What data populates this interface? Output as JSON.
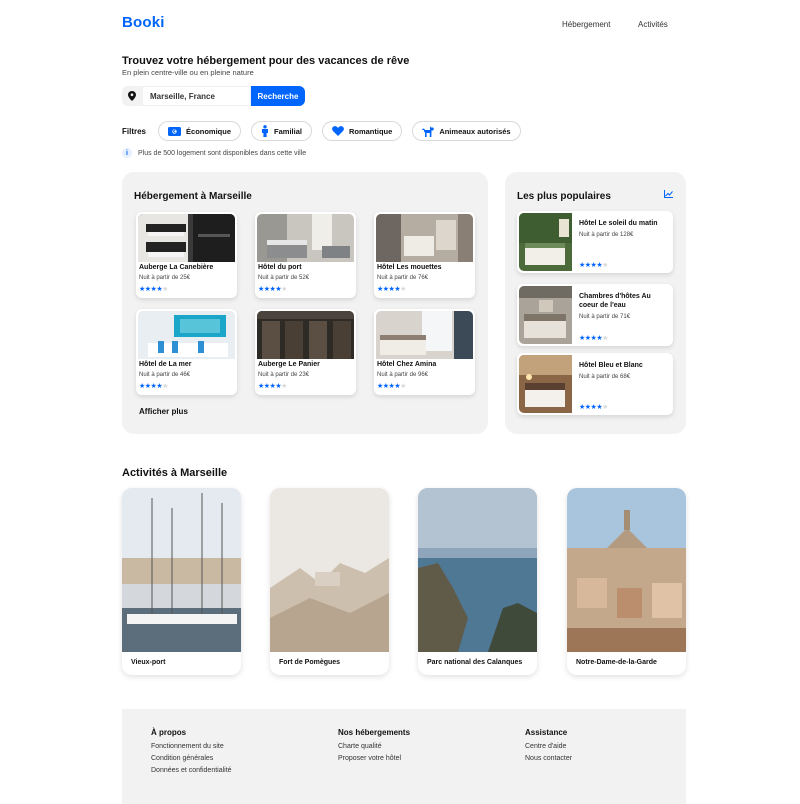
{
  "header": {
    "logo": "Booki",
    "nav": [
      "Hébergement",
      "Activités"
    ]
  },
  "hero": {
    "title": "Trouvez votre hébergement pour des vacances de rêve",
    "subtitle": "En plein centre-ville ou en pleine nature"
  },
  "search": {
    "value": "Marseille, France",
    "button": "Recherche",
    "icon": "location-pin-icon"
  },
  "filters": {
    "label": "Filtres",
    "items": [
      {
        "label": "Économique",
        "icon": "money-icon"
      },
      {
        "label": "Familial",
        "icon": "person-icon"
      },
      {
        "label": "Romantique",
        "icon": "heart-icon"
      },
      {
        "label": "Animeaux autorisés",
        "icon": "dog-icon"
      }
    ]
  },
  "info": {
    "icon_text": "i",
    "text": "Plus de 500 logement sont disponibles dans cette ville"
  },
  "hebergements": {
    "title": "Hébergement à Marseille",
    "more": "Afficher plus",
    "items": [
      {
        "name": "Auberge La Canebière",
        "price": "Nuit à partir de 25€",
        "rating": 4
      },
      {
        "name": "Hôtel du port",
        "price": "Nuit à partir de 52€",
        "rating": 4
      },
      {
        "name": "Hôtel Les mouettes",
        "price": "Nuit à partir de 76€",
        "rating": 4
      },
      {
        "name": "Hôtel de La mer",
        "price": "Nuit à partir de 46€",
        "rating": 4
      },
      {
        "name": "Auberge Le Panier",
        "price": "Nuit à partir de 23€",
        "rating": 4
      },
      {
        "name": "Hôtel Chez Amina",
        "price": "Nuit à partir de 96€",
        "rating": 4
      }
    ]
  },
  "populaires": {
    "title": "Les plus populaires",
    "icon": "trend-chart-icon",
    "items": [
      {
        "name": "Hôtel Le soleil du matin",
        "price": "Nuit à partir de 128€",
        "rating": 4
      },
      {
        "name": "Chambres d'hôtes Au coeur de l'eau",
        "price": "Nuit à partir de 71€",
        "rating": 4
      },
      {
        "name": "Hôtel Bleu et Blanc",
        "price": "Nuit à partir de 68€",
        "rating": 4
      }
    ]
  },
  "activites": {
    "title": "Activités à Marseille",
    "items": [
      {
        "name": "Vieux-port"
      },
      {
        "name": "Fort de Pomègues"
      },
      {
        "name": "Parc national des Calanques"
      },
      {
        "name": "Notre-Dame-de-la-Garde"
      }
    ]
  },
  "footer": {
    "columns": [
      {
        "title": "À propos",
        "links": [
          "Fonctionnement du site",
          "Condition générales",
          "Données et confidentialité"
        ]
      },
      {
        "title": "Nos hébergements",
        "links": [
          "Charte qualité",
          "Proposer votre hôtel"
        ]
      },
      {
        "title": "Assistance",
        "links": [
          "Centre d'aide",
          "Nous contacter"
        ]
      }
    ]
  },
  "colors": {
    "accent": "#0065fc",
    "panel": "#f2f2f2"
  }
}
